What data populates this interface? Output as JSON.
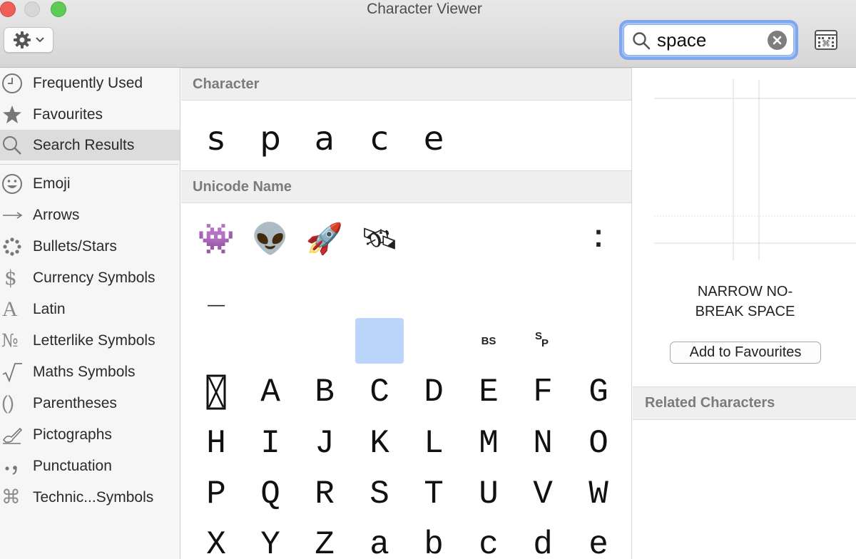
{
  "window": {
    "title": "Character Viewer"
  },
  "toolbar": {
    "gear_icon": "gear-icon",
    "search_value": "space",
    "search_placeholder": ""
  },
  "sidebar": {
    "items": [
      {
        "label": "Frequently Used",
        "icon": "clock-icon"
      },
      {
        "label": "Favourites",
        "icon": "star-icon"
      },
      {
        "label": "Search Results",
        "icon": "magnifier-icon",
        "selected": true
      },
      {
        "label": "Emoji",
        "icon": "smiley-icon"
      },
      {
        "label": "Arrows",
        "icon": "arrow-icon"
      },
      {
        "label": "Bullets/Stars",
        "icon": "asterisk-icon"
      },
      {
        "label": "Currency Symbols",
        "icon": "dollar-icon"
      },
      {
        "label": "Latin",
        "icon": "latin-a-icon"
      },
      {
        "label": "Letterlike Symbols",
        "icon": "numero-icon"
      },
      {
        "label": "Maths Symbols",
        "icon": "square-root-icon"
      },
      {
        "label": "Parentheses",
        "icon": "parentheses-icon"
      },
      {
        "label": "Pictographs",
        "icon": "writing-hand-icon"
      },
      {
        "label": "Punctuation",
        "icon": "punctuation-icon"
      },
      {
        "label": "Technic...Symbols",
        "icon": "command-icon"
      }
    ]
  },
  "main": {
    "character_header": "Character",
    "character_results": [
      "s",
      "p",
      "a",
      "c",
      "e"
    ],
    "unicode_header": "Unicode Name",
    "emoji_row": [
      "👾",
      "👽",
      "🚀",
      "🛰"
    ],
    "colon_glyph": "⁚",
    "underscore_glyph": "_",
    "control_labels": {
      "bs": "BS",
      "sp_s": "S",
      "sp_p": "P"
    },
    "replacement_glyph": "␥",
    "letters": [
      [
        "A",
        "B",
        "C",
        "D",
        "E",
        "F",
        "G"
      ],
      [
        "H",
        "I",
        "J",
        "K",
        "L",
        "M",
        "N",
        "O"
      ],
      [
        "P",
        "Q",
        "R",
        "S",
        "T",
        "U",
        "V",
        "W"
      ],
      [
        "X",
        "Y",
        "Z",
        "a",
        "b",
        "c",
        "d",
        "e"
      ]
    ]
  },
  "detail": {
    "name_line1": "NARROW NO-",
    "name_line2": "BREAK SPACE",
    "add_favourites": "Add to Favourites",
    "related_header": "Related Characters"
  },
  "colors": {
    "selection": "#bcd6fb",
    "search_focus": "#7fa7ef",
    "close": "#ee5f58",
    "maximize": "#5ecb55"
  }
}
